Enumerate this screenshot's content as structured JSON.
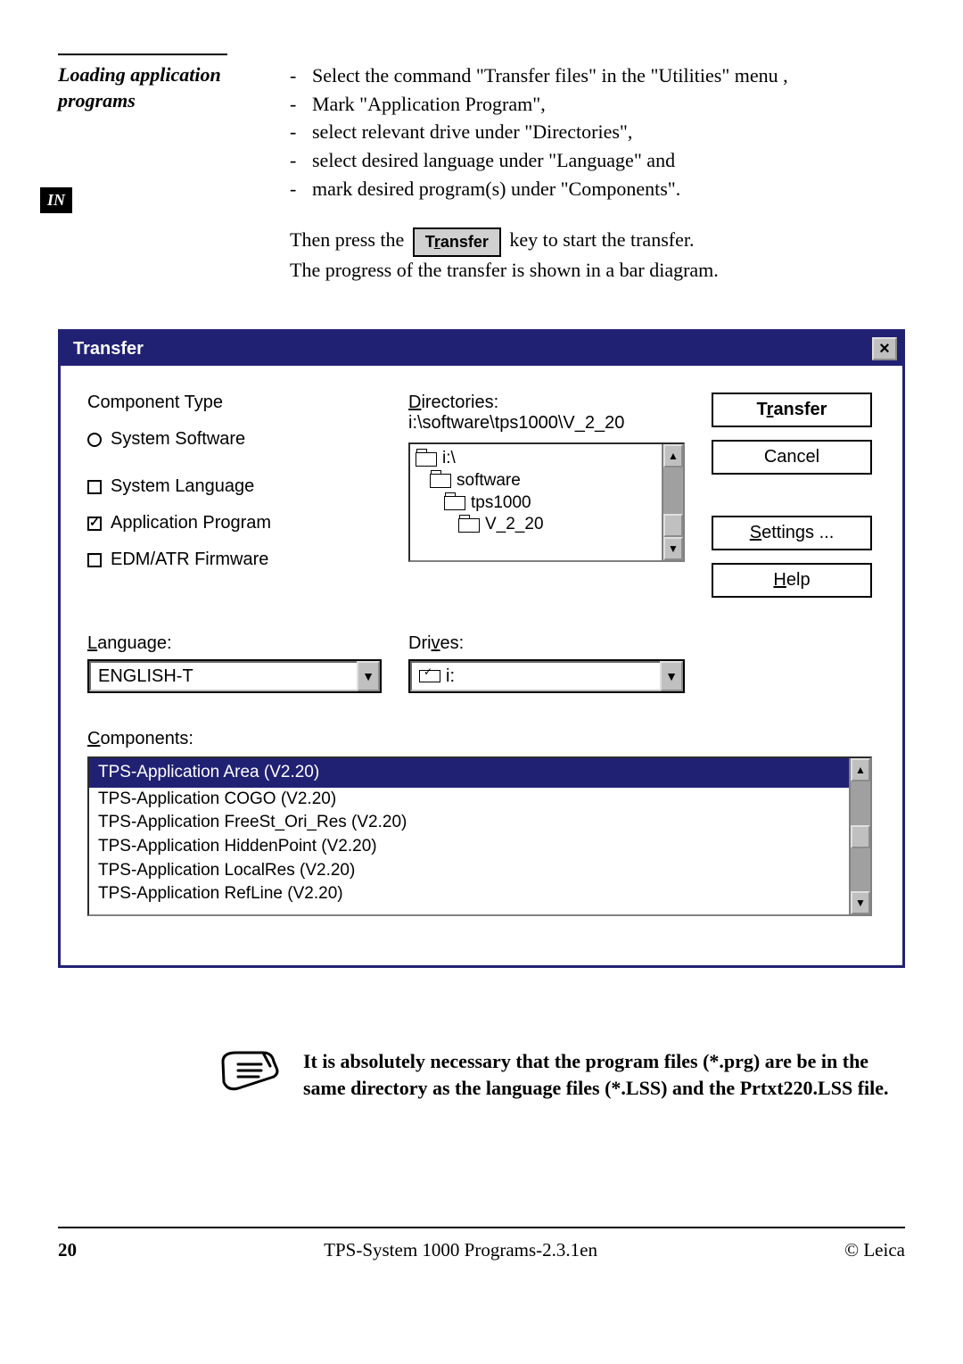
{
  "sideHeading": "Loading application programs",
  "sideTab": "IN",
  "bullets": [
    "Select the command \"Transfer files\" in the \"Utilities\" menu ,",
    "Mark \"Application Program\",",
    "select relevant drive under \"Directories\",",
    "select desired language under \"Language\" and",
    "mark desired program(s) under \"Components\"."
  ],
  "press_before": "Then press the",
  "press_button": "Transfer",
  "press_after": "key to start the transfer.",
  "progress_line": "The progress of the transfer is shown in a bar diagram.",
  "dialog": {
    "title": "Transfer",
    "componentType": {
      "label": "Component Type",
      "systemSoftware": "System Software",
      "systemLanguage": "System Language",
      "applicationProgram": "Application Program",
      "edmAtr": "EDM/ATR Firmware"
    },
    "directories": {
      "label": "Directories:",
      "path": "i:\\software\\tps1000\\V_2_20",
      "items": [
        "i:\\",
        "software",
        "tps1000",
        "V_2_20"
      ]
    },
    "buttons": {
      "transfer": "Transfer",
      "cancel": "Cancel",
      "settings": "Settings ...",
      "help": "Help"
    },
    "language": {
      "label": "Language:",
      "value": "ENGLISH-T"
    },
    "drives": {
      "label": "Drives:",
      "value": "i:"
    },
    "components": {
      "label": "Components:",
      "items": [
        "TPS-Application Area (V2.20)",
        "TPS-Application COGO (V2.20)",
        "TPS-Application FreeSt_Ori_Res (V2.20)",
        "TPS-Application HiddenPoint (V2.20)",
        "TPS-Application LocalRes (V2.20)",
        "TPS-Application RefLine (V2.20)"
      ]
    }
  },
  "note": "It is absolutely necessary that the program files (*.prg) are be in the same directory as the language files (*.LSS) and the Prtxt220.LSS file.",
  "footer": {
    "pageNum": "20",
    "center": "TPS-System 1000 Programs-2.3.1en",
    "right": "© Leica"
  }
}
